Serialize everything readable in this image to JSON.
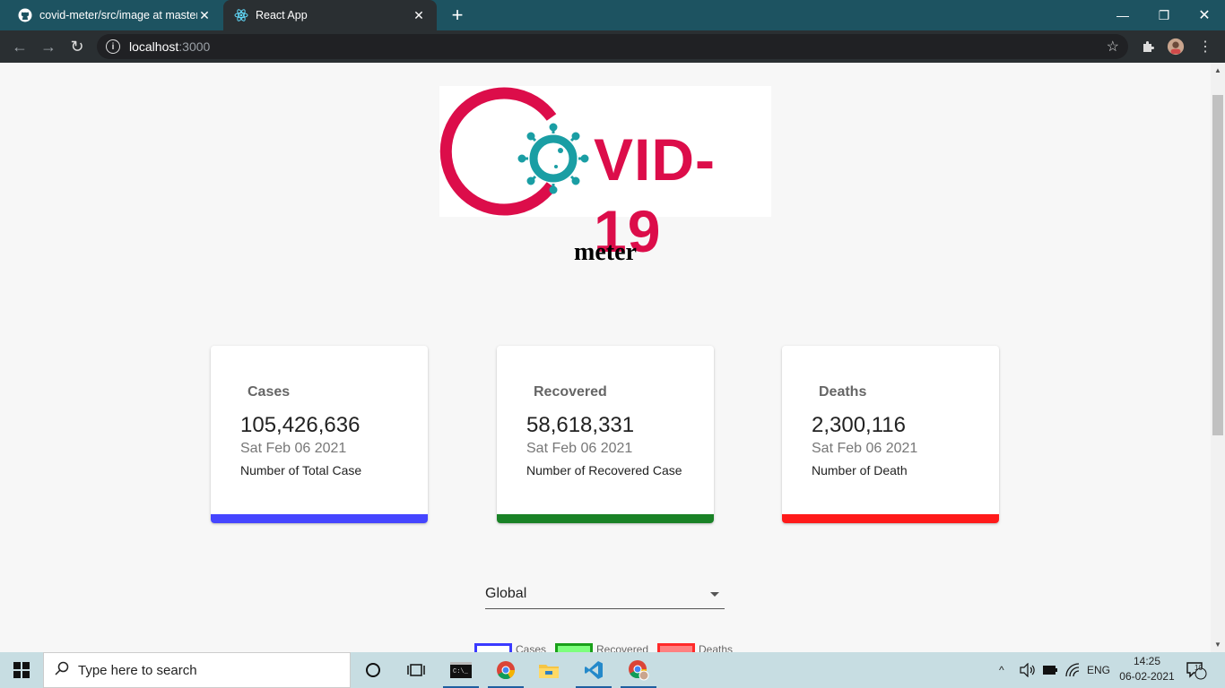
{
  "browser": {
    "tabs": [
      {
        "title": "covid-meter/src/image at master",
        "favicon": "github-icon",
        "active": false
      },
      {
        "title": "React App",
        "favicon": "react-icon",
        "active": true
      }
    ],
    "address": {
      "host": "localhost",
      "port": ":3000"
    }
  },
  "page": {
    "logo_text": "VID-19",
    "subtitle": "meter",
    "cards": [
      {
        "label": "Cases",
        "value": "105,426,636",
        "date": "Sat Feb 06 2021",
        "description": "Number of Total Case",
        "color": "#4545ff"
      },
      {
        "label": "Recovered",
        "value": "58,618,331",
        "date": "Sat Feb 06 2021",
        "description": "Number of Recovered Case",
        "color": "#198226"
      },
      {
        "label": "Deaths",
        "value": "2,300,116",
        "date": "Sat Feb 06 2021",
        "description": "Number of Death",
        "color": "#ff1a1a"
      }
    ],
    "country_select": {
      "value": "Global"
    },
    "legend": [
      {
        "label": "Cases",
        "border": "#3a3aff",
        "fill": "#ffffff"
      },
      {
        "label": "Recovered",
        "border": "#1aa01a",
        "fill": "#7dff7d"
      },
      {
        "label": "Deaths",
        "border": "#ff2a2a",
        "fill": "#ff8080"
      }
    ]
  },
  "taskbar": {
    "search_placeholder": "Type here to search",
    "language": "ENG",
    "time": "14:25",
    "date": "06-02-2021",
    "notification_count": "10"
  },
  "colors": {
    "tabbar": "#1d5361",
    "logo_red": "#dc0d4a",
    "logo_teal": "#1a9ea4"
  }
}
